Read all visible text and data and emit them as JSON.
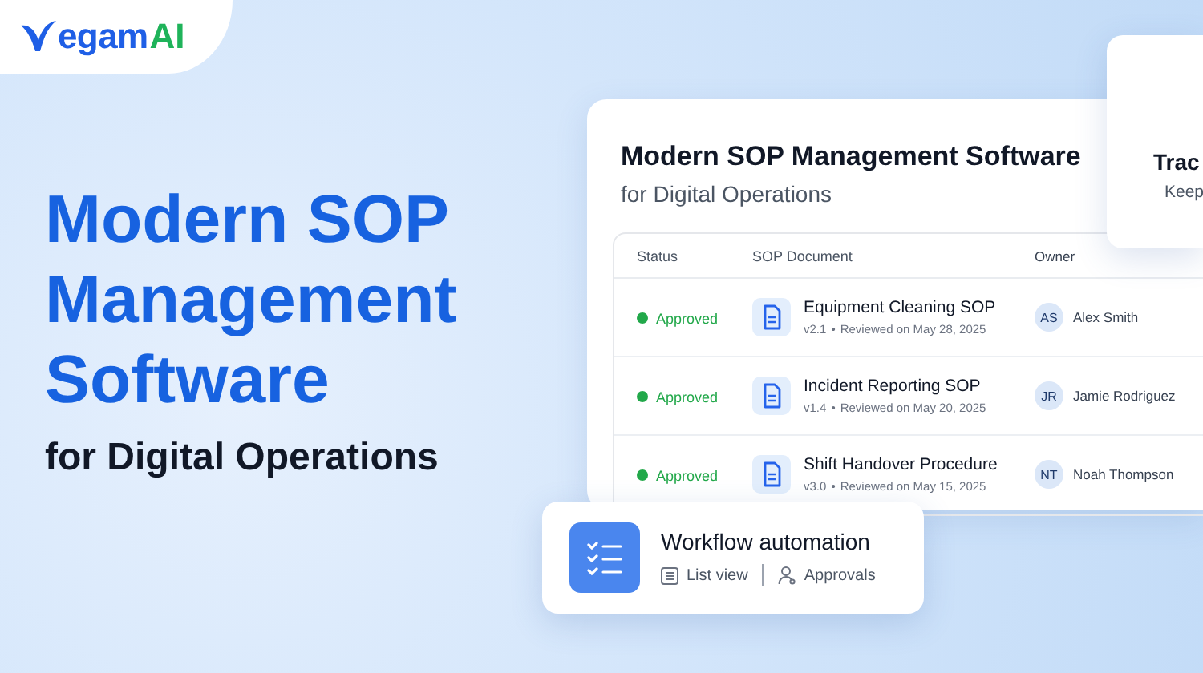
{
  "logo": {
    "brand": "egam",
    "accent": "AI"
  },
  "hero": {
    "headline": "Modern SOP Management Software",
    "subheadline": "for Digital Operations"
  },
  "sop_card": {
    "title": "Modern SOP Management Software",
    "subtitle": "for Digital Operations",
    "table": {
      "columns": [
        "Status",
        "SOP Document",
        "Owner"
      ],
      "rows": [
        {
          "status": "Approved",
          "document": "Equipment Cleaning SOP",
          "version": "v2.1",
          "separator": "•",
          "reviewed": "Reviewed on May 28, 2025",
          "initials": "AS",
          "owner": "Alex Smith"
        },
        {
          "status": "Approved",
          "document": "Incident Reporting SOP",
          "version": "v1.4",
          "separator": "•",
          "reviewed": "Reviewed on May 20, 2025",
          "initials": "JR",
          "owner": "Jamie Rodriguez"
        },
        {
          "status": "Approved",
          "document": "Shift Handover Procedure",
          "version": "v3.0",
          "separator": "•",
          "reviewed": "Reviewed on May 15, 2025",
          "initials": "NT",
          "owner": "Noah Thompson"
        }
      ]
    }
  },
  "track_card": {
    "title": "Trac",
    "subtitle": "Keep"
  },
  "workflow_card": {
    "title": "Workflow automation",
    "tags": [
      {
        "kind": "list",
        "label": "List view"
      },
      {
        "kind": "person",
        "label": "Approvals"
      }
    ]
  }
}
